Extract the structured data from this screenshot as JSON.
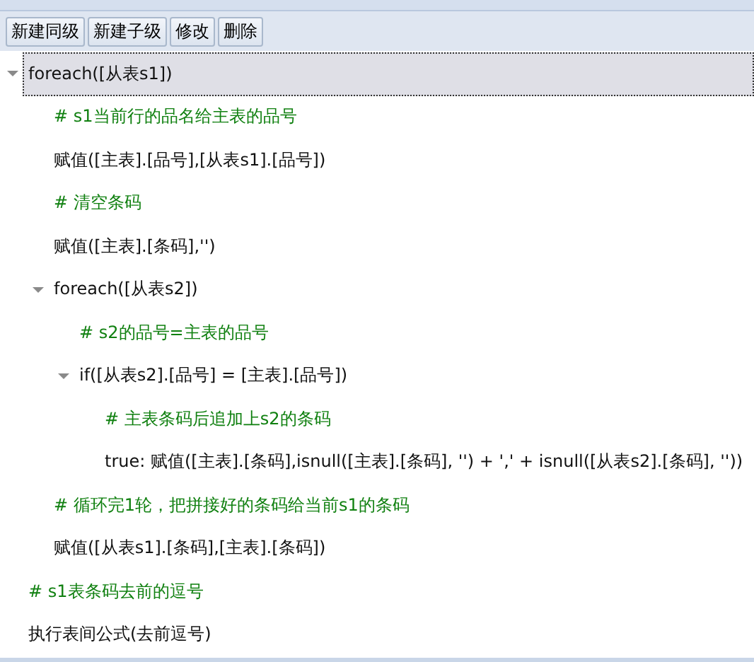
{
  "toolbar": {
    "buttons": [
      "新建同级",
      "新建子级",
      "修改",
      "删除"
    ]
  },
  "tree": [
    {
      "text": "foreach([从表s1])",
      "kind": "code",
      "expanded": true,
      "selected": true,
      "children": [
        {
          "text": "# s1当前行的品名给主表的品号",
          "kind": "comment",
          "selected": false
        },
        {
          "text": "赋值([主表].[品号],[从表s1].[品号])",
          "kind": "code",
          "selected": false
        },
        {
          "text": "# 清空条码",
          "kind": "comment",
          "selected": false
        },
        {
          "text": "赋值([主表].[条码],'')",
          "kind": "code",
          "selected": false
        },
        {
          "text": "foreach([从表s2])",
          "kind": "code",
          "expanded": true,
          "selected": false,
          "children": [
            {
              "text": "# s2的品号=主表的品号",
              "kind": "comment",
              "selected": false
            },
            {
              "text": "if([从表s2].[品号] = [主表].[品号])",
              "kind": "code",
              "expanded": true,
              "selected": false,
              "children": [
                {
                  "text": "# 主表条码后追加上s2的条码",
                  "kind": "comment",
                  "selected": false
                },
                {
                  "text": "true: 赋值([主表].[条码],isnull([主表].[条码], '') + ',' + isnull([从表s2].[条码], ''))",
                  "kind": "code",
                  "selected": false
                }
              ]
            }
          ]
        },
        {
          "text": "# 循环完1轮，把拼接好的条码给当前s1的条码",
          "kind": "comment",
          "selected": false
        },
        {
          "text": "赋值([从表s1].[条码],[主表].[条码])",
          "kind": "code",
          "selected": false
        }
      ]
    },
    {
      "text": "# s1表条码去前的逗号",
      "kind": "comment",
      "selected": false
    },
    {
      "text": "执行表间公式(去前逗号)",
      "kind": "code",
      "selected": false
    }
  ]
}
